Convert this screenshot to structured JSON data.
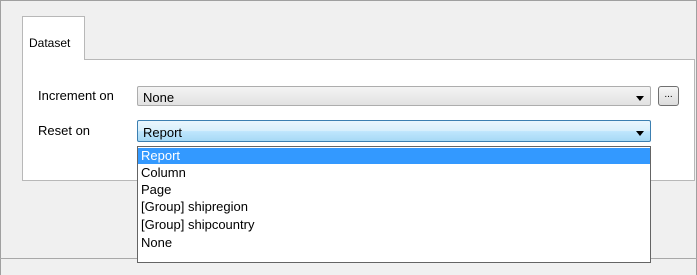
{
  "tabs": [
    {
      "label": "Dataset"
    }
  ],
  "form": {
    "increment_label": "Increment on",
    "increment_value": "None",
    "browse_button": "...",
    "reset_label": "Reset on",
    "reset_value": "Report"
  },
  "dropdown": {
    "options": [
      "Report",
      "Column",
      "Page",
      "[Group] shipregion",
      "[Group] shipcountry",
      "None"
    ],
    "selected": "Report"
  },
  "colors": {
    "selection": "#3399ff",
    "combo_open_border": "#3c7fb1"
  }
}
